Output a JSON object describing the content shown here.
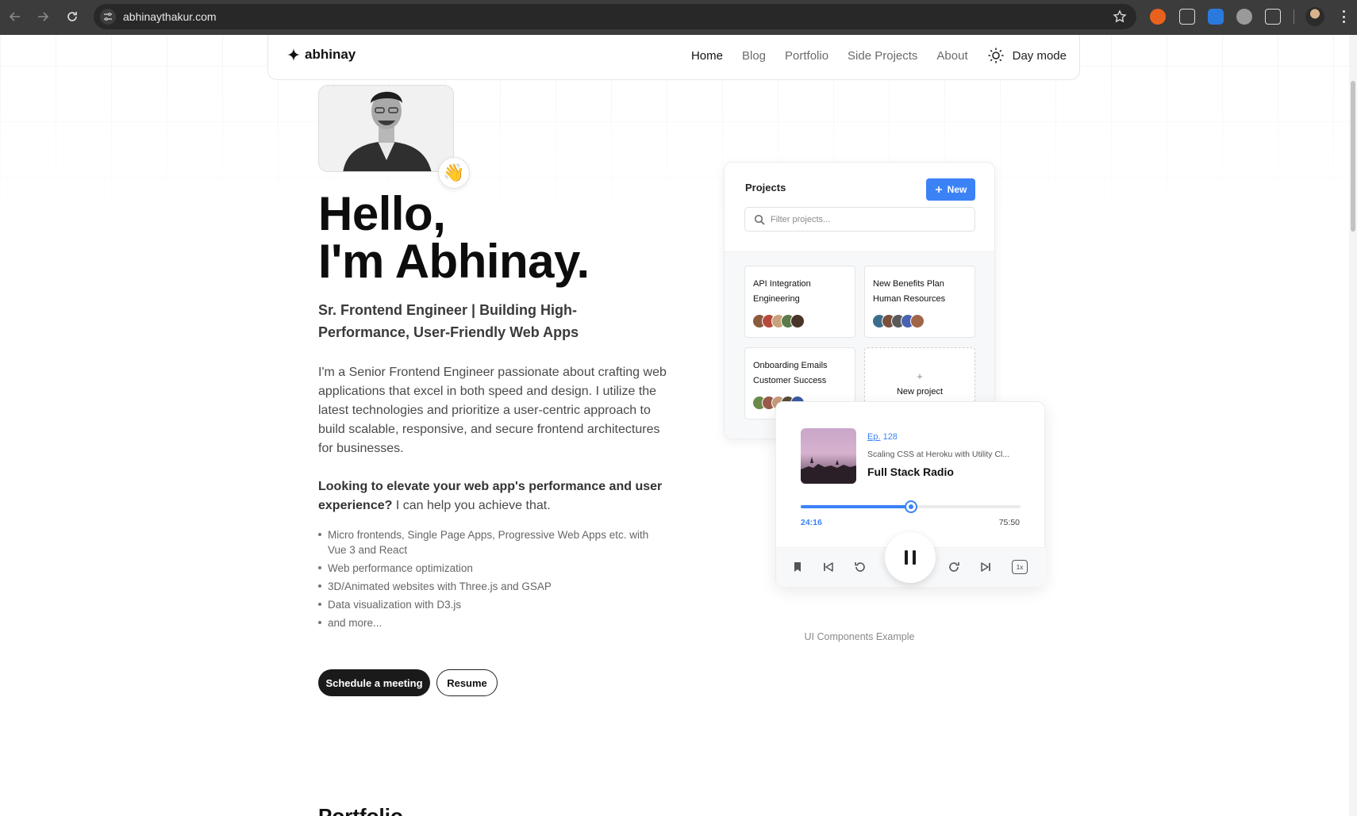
{
  "browser": {
    "url": "abhinaythakur.com"
  },
  "header": {
    "brand": "abhinay",
    "nav": [
      {
        "label": "Home"
      },
      {
        "label": "Blog"
      },
      {
        "label": "Portfolio"
      },
      {
        "label": "Side Projects"
      },
      {
        "label": "About"
      }
    ],
    "theme_toggle": "Day mode"
  },
  "hero": {
    "wave_emoji": "👋",
    "headline_line1": "Hello,",
    "headline_line2": "I'm Abhinay.",
    "subheading": "Sr. Frontend Engineer | Building High-Performance, User-Friendly Web Apps",
    "intro": "I'm a Senior Frontend Engineer passionate about crafting web applications that excel in both speed and design. I utilize the latest technologies and prioritize a user-centric approach to build scalable, responsive, and secure frontend architectures for businesses.",
    "pitch_bold": "Looking to elevate your web app's performance and user experience?",
    "pitch_rest": " I can help you achieve that.",
    "skills": [
      "Micro frontends, Single Page Apps, Progressive Web Apps etc. with Vue 3 and React",
      "Web performance optimization",
      "3D/Animated websites with Three.js and GSAP",
      "Data visualization with D3.js",
      "and more..."
    ],
    "cta_primary": "Schedule a meeting",
    "cta_secondary": "Resume"
  },
  "projects_widget": {
    "title": "Projects",
    "new_button": "New",
    "filter_placeholder": "Filter projects...",
    "projects": [
      {
        "name": "API Integration",
        "team": "Engineering"
      },
      {
        "name": "New Benefits Plan",
        "team": "Human Resources"
      },
      {
        "name": "Onboarding Emails",
        "team": "Customer Success"
      }
    ],
    "new_project": "New project",
    "new_project_plus": "+"
  },
  "player_widget": {
    "episode_prefix": "Ep.",
    "episode_number": " 128",
    "episode_title": "Scaling CSS at Heroku with Utility Cl...",
    "show_name": "Full Stack Radio",
    "current_time": "24:16",
    "total_time": "75:50",
    "progress": 0.5,
    "speed": "1x"
  },
  "components_caption": "UI Components Example",
  "next_section_title": "Portfolio",
  "colors": {
    "accent": "#3b82f6",
    "chrome": "#3c3c3c",
    "button_dark": "#1a1a1a"
  }
}
